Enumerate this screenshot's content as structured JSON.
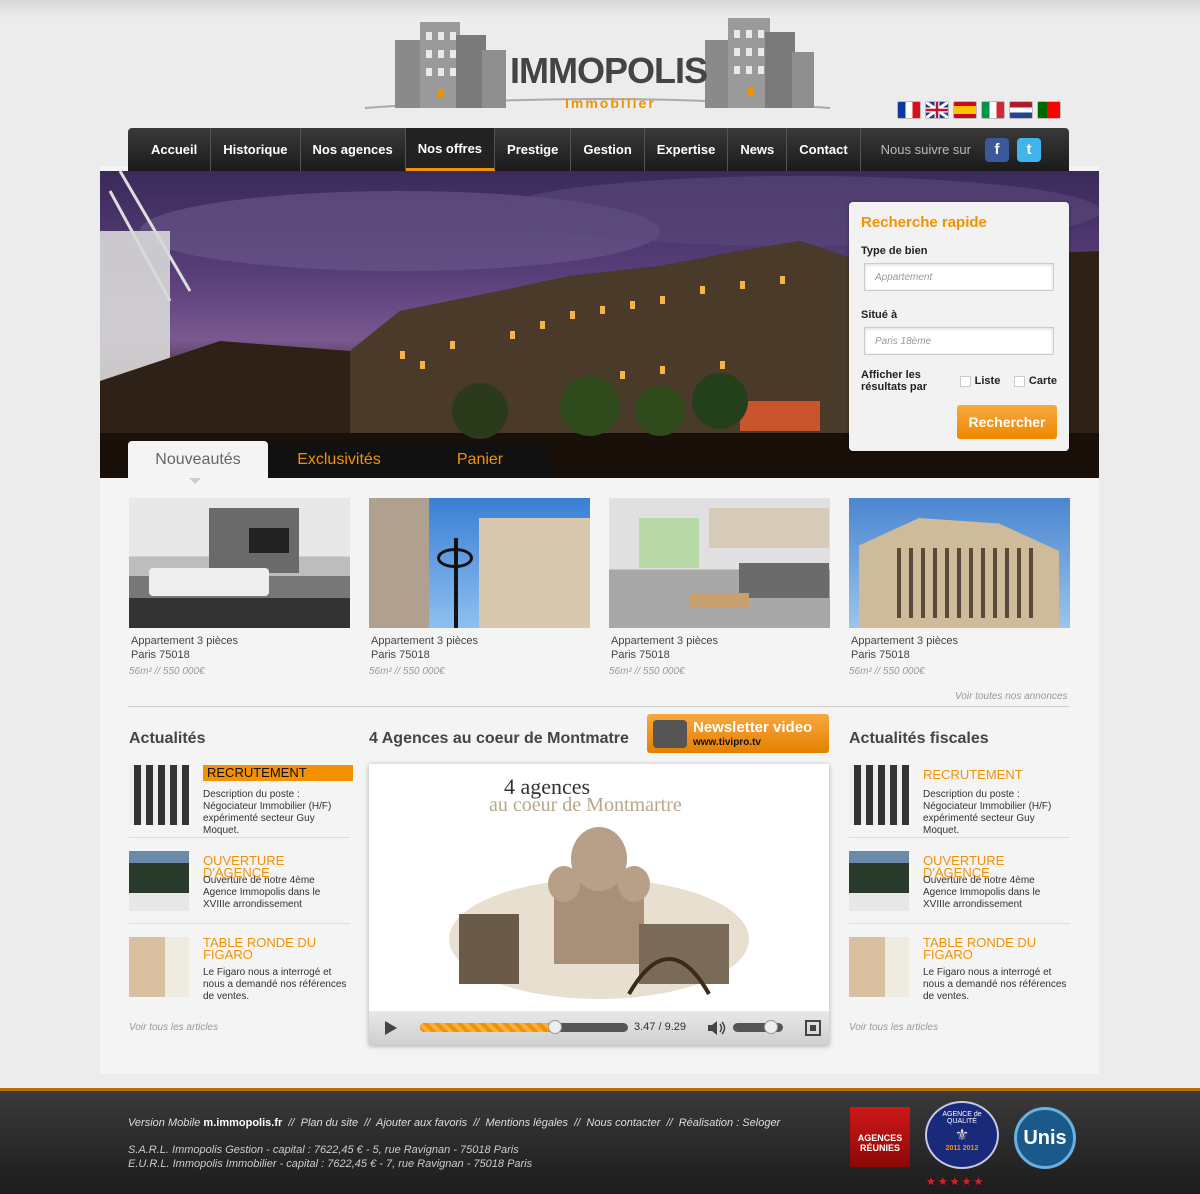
{
  "brand": {
    "name_a": "IMMO",
    "name_b": "POLIS",
    "subtitle": "Immobilier"
  },
  "languages": [
    "fr",
    "en",
    "es",
    "it",
    "nl",
    "pt"
  ],
  "nav": {
    "items": [
      "Accueil",
      "Historique",
      "Nos agences",
      "Nos offres",
      "Prestige",
      "Gestion",
      "Expertise",
      "News",
      "Contact"
    ],
    "active": "Nos offres",
    "follow": "Nous suivre sur",
    "facebook": "f",
    "twitter": "t"
  },
  "search": {
    "title": "Recherche rapide",
    "type_label": "Type de bien",
    "type_placeholder": "Appartement",
    "loc_label": "Situé à",
    "loc_placeholder": "Paris 18ème",
    "display_label_1": "Afficher les",
    "display_label_2": "résultats par",
    "opt_list": "Liste",
    "opt_map": "Carte",
    "button": "Rechercher"
  },
  "tabs": [
    "Nouveautés",
    "Exclusivités",
    "Panier"
  ],
  "listings": [
    {
      "title": "Appartement 3 pièces",
      "city": "Paris 75018",
      "meta": "56m²  //  550 000€"
    },
    {
      "title": "Appartement 3 pièces",
      "city": "Paris 75018",
      "meta": "56m²  //  550 000€"
    },
    {
      "title": "Appartement 3 pièces",
      "city": "Paris 75018",
      "meta": "56m²  //  550 000€"
    },
    {
      "title": "Appartement 3 pièces",
      "city": "Paris 75018",
      "meta": "56m²  //  550 000€"
    }
  ],
  "see_all_listings": "Voir toutes nos annonces",
  "news_left": {
    "heading": "Actualités",
    "more": "Voir tous les articles",
    "items": [
      {
        "title": "RECRUTEMENT",
        "text": "Description du poste : Négociateur Immobilier (H/F) expérimenté secteur Guy Moquet."
      },
      {
        "title": "OUVERTURE D'AGENCE",
        "text": "Ouverture de notre 4ème Agence Immopolis dans le XVIIIe arrondissement"
      },
      {
        "title": "TABLE RONDE DU FIGARO",
        "text": "Le Figaro nous a interrogé et nous a demandé nos références de ventes."
      }
    ]
  },
  "video": {
    "heading": "4 Agences au coeur de Montmatre",
    "newsletter": "Newsletter video",
    "newsletter_url": "www.tivipro.tv",
    "title_1": "4 agences",
    "title_2": "au coeur de Montmartre",
    "time": "3.47 / 9.29",
    "progress": 0.65,
    "volume": 0.75
  },
  "news_right": {
    "heading": "Actualités fiscales",
    "more": "Voir tous les articles",
    "items": [
      {
        "title": "RECRUTEMENT",
        "text": "Description du poste : Négociateur Immobilier (H/F) expérimenté secteur Guy Moquet."
      },
      {
        "title": "OUVERTURE D'AGENCE",
        "text": "Ouverture de notre 4ème Agence Immopolis dans le XVIIIe arrondissement"
      },
      {
        "title": "TABLE RONDE DU FIGARO",
        "text": "Le Figaro nous a interrogé et nous a demandé nos références de ventes."
      }
    ]
  },
  "footer": {
    "mobile_label": "Version Mobile",
    "mobile_url": "m.immopolis.fr",
    "links": [
      "Plan du site",
      "Ajouter aux favoris",
      "Mentions légales",
      "Nous contacter",
      "Réalisation : Seloger"
    ],
    "addr_1": "S.A.R.L. Immopolis Gestion - capital : 7622,45 € - 5, rue Ravignan - 75018 Paris",
    "addr_2": "E.U.R.L. Immopolis Immobilier - capital : 7622,45 € - 7, rue Ravignan - 75018 Paris",
    "badge_1": "AGENCES RÉUNIES",
    "badge_2_top": "AGENCE de QUALITÉ",
    "badge_2_years": "2011   2012",
    "badge_3": "Unis"
  }
}
